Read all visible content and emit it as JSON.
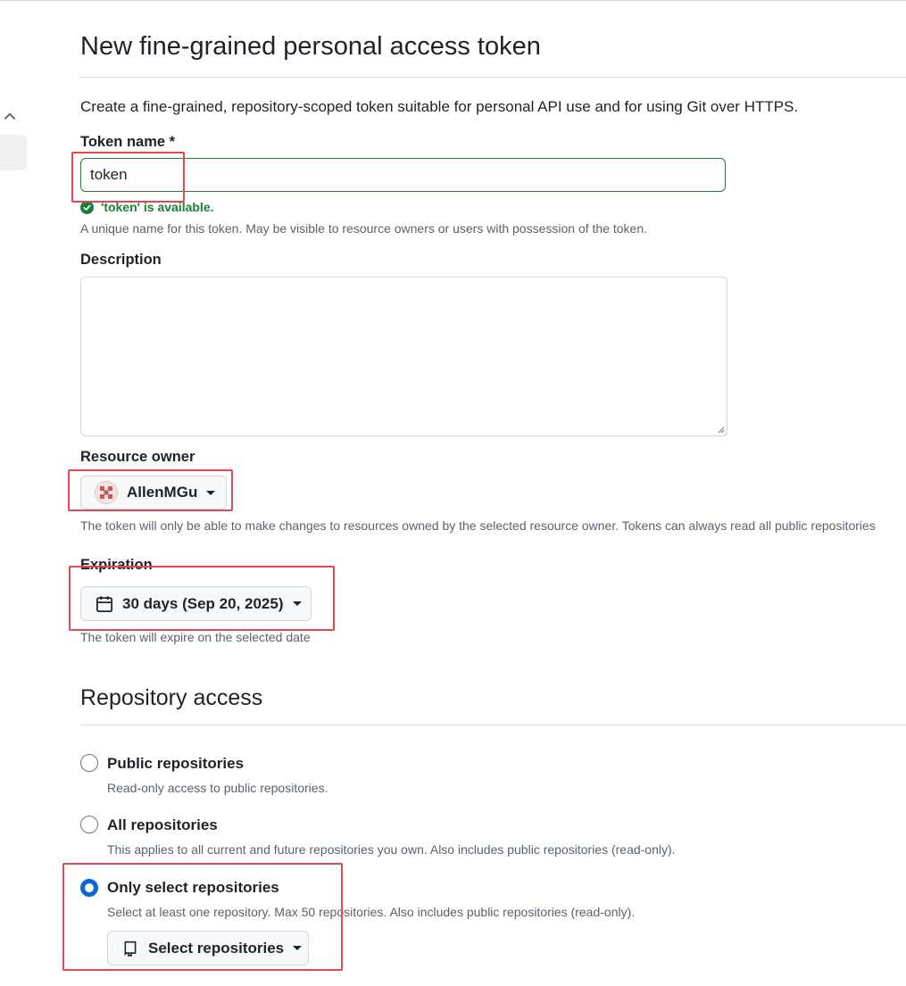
{
  "page": {
    "title": "New fine-grained personal access token",
    "lead": "Create a fine-grained, repository-scoped token suitable for personal API use and for using Git over HTTPS."
  },
  "token_name": {
    "label": "Token name *",
    "value": "token",
    "status": "'token' is available.",
    "help": "A unique name for this token. May be visible to resource owners or users with possession of the token."
  },
  "description": {
    "label": "Description",
    "value": ""
  },
  "resource_owner": {
    "label": "Resource owner",
    "selected": "AllenMGu",
    "help": "The token will only be able to make changes to resources owned by the selected resource owner. Tokens can always read all public repositories"
  },
  "expiration": {
    "label": "Expiration",
    "selected": "30 days (Sep 20, 2025)",
    "help": "The token will expire on the selected date"
  },
  "repository_access": {
    "heading": "Repository access",
    "options": [
      {
        "label": "Public repositories",
        "help": "Read-only access to public repositories.",
        "checked": false
      },
      {
        "label": "All repositories",
        "help": "This applies to all current and future repositories you own. Also includes public repositories (read-only).",
        "checked": false
      },
      {
        "label": "Only select repositories",
        "help": "Select at least one repository. Max 50 repositories. Also includes public repositories (read-only).",
        "checked": true
      }
    ],
    "select_button": "Select repositories"
  },
  "colors": {
    "accent": "#0969da",
    "success": "#1a7f37",
    "annotation": "#e5484d"
  }
}
